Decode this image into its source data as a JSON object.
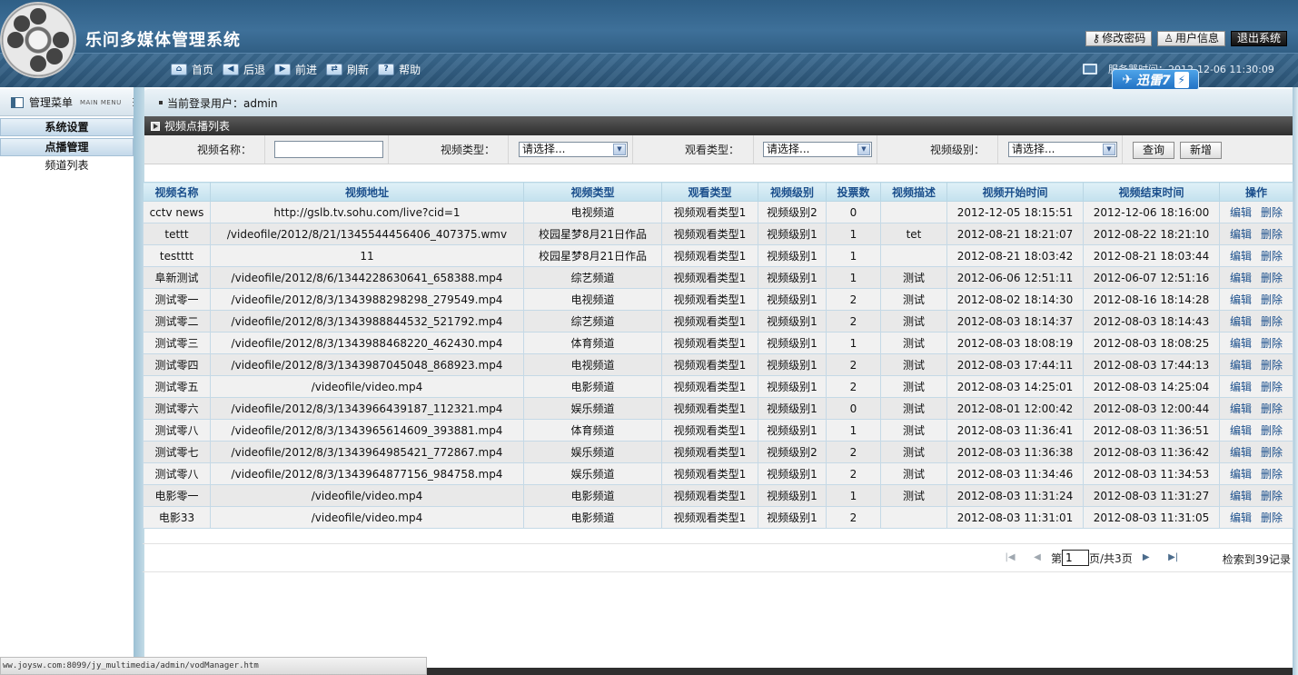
{
  "app": {
    "title": "乐问多媒体管理系统",
    "buttons": [
      "修改密码",
      "用户信息",
      "退出系统"
    ],
    "nav": [
      "首页",
      "后退",
      "前进",
      "刷新",
      "帮助"
    ],
    "server_time": "服务器时间：2012-12-06 11:30:09",
    "xunlei": "迅雷7"
  },
  "sidebar": {
    "title": "管理菜单",
    "title_en": "MAIN MENU",
    "groups": [
      "系统设置",
      "点播管理"
    ],
    "items": [
      "频道列表"
    ]
  },
  "user_bar": {
    "label": "当前登录用户：admin"
  },
  "panel": {
    "title": "视频点播列表",
    "filters": {
      "name_label": "视频名称：",
      "name_value": "",
      "type_label": "视频类型：",
      "type_value": "请选择...",
      "watch_label": "观看类型：",
      "watch_value": "请选择...",
      "level_label": "视频级别：",
      "level_value": "请选择...",
      "query_btn": "查询",
      "add_btn": "新增"
    }
  },
  "table": {
    "headers": [
      "视频名称",
      "视频地址",
      "视频类型",
      "观看类型",
      "视频级别",
      "投票数",
      "视频描述",
      "视频开始时间",
      "视频结束时间",
      "操作"
    ],
    "edit_label": "编辑",
    "delete_label": "删除",
    "rows": [
      [
        "cctv news",
        "http://gslb.tv.sohu.com/live?cid=1",
        "电视频道",
        "视频观看类型1",
        "视频级别2",
        "0",
        "",
        "2012-12-05 18:15:51",
        "2012-12-06 18:16:00"
      ],
      [
        "tettt",
        "/videofile/2012/8/21/1345544456406_407375.wmv",
        "校园星梦8月21日作品",
        "视频观看类型1",
        "视频级别1",
        "1",
        "tet",
        "2012-08-21 18:21:07",
        "2012-08-22 18:21:10"
      ],
      [
        "testttt",
        "11",
        "校园星梦8月21日作品",
        "视频观看类型1",
        "视频级别1",
        "1",
        "",
        "2012-08-21 18:03:42",
        "2012-08-21 18:03:44"
      ],
      [
        "阜新测试",
        "/videofile/2012/8/6/1344228630641_658388.mp4",
        "综艺频道",
        "视频观看类型1",
        "视频级别1",
        "1",
        "测试",
        "2012-06-06 12:51:11",
        "2012-06-07 12:51:16"
      ],
      [
        "测试零一",
        "/videofile/2012/8/3/1343988298298_279549.mp4",
        "电视频道",
        "视频观看类型1",
        "视频级别1",
        "2",
        "测试",
        "2012-08-02 18:14:30",
        "2012-08-16 18:14:28"
      ],
      [
        "测试零二",
        "/videofile/2012/8/3/1343988844532_521792.mp4",
        "综艺频道",
        "视频观看类型1",
        "视频级别1",
        "2",
        "测试",
        "2012-08-03 18:14:37",
        "2012-08-03 18:14:43"
      ],
      [
        "测试零三",
        "/videofile/2012/8/3/1343988468220_462430.mp4",
        "体育频道",
        "视频观看类型1",
        "视频级别1",
        "1",
        "测试",
        "2012-08-03 18:08:19",
        "2012-08-03 18:08:25"
      ],
      [
        "测试零四",
        "/videofile/2012/8/3/1343987045048_868923.mp4",
        "电视频道",
        "视频观看类型1",
        "视频级别1",
        "2",
        "测试",
        "2012-08-03 17:44:11",
        "2012-08-03 17:44:13"
      ],
      [
        "测试零五",
        "/videofile/video.mp4",
        "电影频道",
        "视频观看类型1",
        "视频级别1",
        "2",
        "测试",
        "2012-08-03 14:25:01",
        "2012-08-03 14:25:04"
      ],
      [
        "测试零六",
        "/videofile/2012/8/3/1343966439187_112321.mp4",
        "娱乐频道",
        "视频观看类型1",
        "视频级别1",
        "0",
        "测试",
        "2012-08-01 12:00:42",
        "2012-08-03 12:00:44"
      ],
      [
        "测试零八",
        "/videofile/2012/8/3/1343965614609_393881.mp4",
        "体育频道",
        "视频观看类型1",
        "视频级别1",
        "1",
        "测试",
        "2012-08-03 11:36:41",
        "2012-08-03 11:36:51"
      ],
      [
        "测试零七",
        "/videofile/2012/8/3/1343964985421_772867.mp4",
        "娱乐频道",
        "视频观看类型1",
        "视频级别2",
        "2",
        "测试",
        "2012-08-03 11:36:38",
        "2012-08-03 11:36:42"
      ],
      [
        "测试零八",
        "/videofile/2012/8/3/1343964877156_984758.mp4",
        "娱乐频道",
        "视频观看类型1",
        "视频级别1",
        "2",
        "测试",
        "2012-08-03 11:34:46",
        "2012-08-03 11:34:53"
      ],
      [
        "电影零一",
        "/videofile/video.mp4",
        "电影频道",
        "视频观看类型1",
        "视频级别1",
        "1",
        "测试",
        "2012-08-03 11:31:24",
        "2012-08-03 11:31:27"
      ],
      [
        "电影33",
        "/videofile/video.mp4",
        "电影频道",
        "视频观看类型1",
        "视频级别1",
        "2",
        "",
        "2012-08-03 11:31:01",
        "2012-08-03 11:31:05"
      ]
    ]
  },
  "pager": {
    "prefix": "第",
    "current": "1",
    "suffix": "页/共3页",
    "total": "检索到39记录"
  },
  "statusbar": {
    "url": "ww.joysw.com:8099/jy_multimedia/admin/vodManager.htm"
  }
}
